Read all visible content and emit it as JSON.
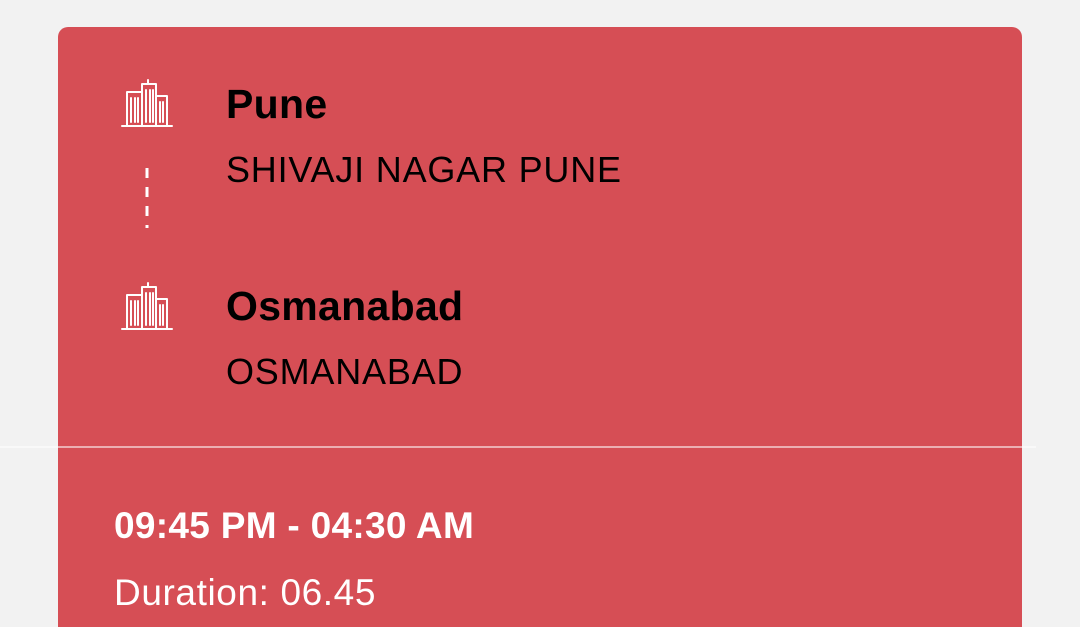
{
  "route": {
    "origin": {
      "city": "Pune",
      "stop": "SHIVAJI NAGAR PUNE",
      "icon": "building-icon"
    },
    "destination": {
      "city": "Osmanabad",
      "stop": "OSMANABAD",
      "icon": "building-icon"
    }
  },
  "schedule": {
    "time_range": "09:45 PM - 04:30 AM",
    "duration_label": "Duration:",
    "duration_value": "06.45"
  },
  "colors": {
    "card_background": "#d64e55",
    "page_background": "#f2f2f2",
    "text": "#ffffff"
  }
}
